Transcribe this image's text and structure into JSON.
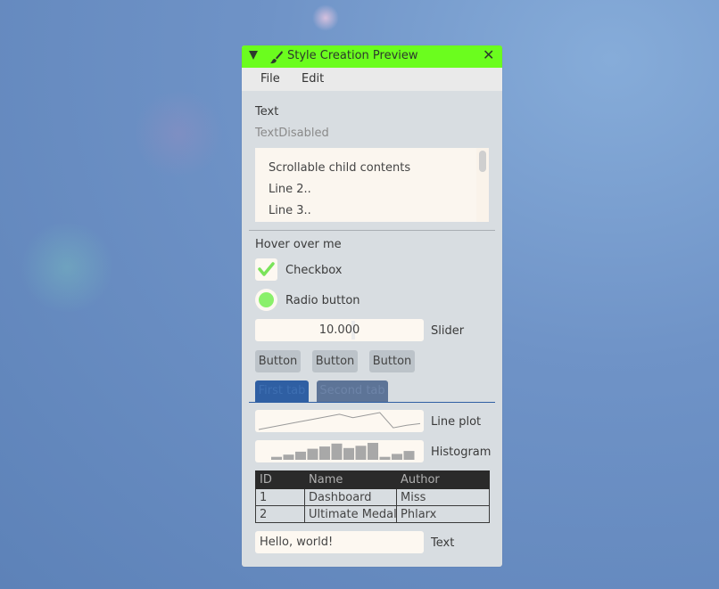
{
  "window": {
    "title": "Style Creation Preview",
    "title_bar_color": "#6bfd1e",
    "icons": [
      "collapse-arrow-icon",
      "paintbrush-icon",
      "close-icon"
    ]
  },
  "menu": {
    "file": "File",
    "edit": "Edit"
  },
  "text_label": "Text",
  "text_disabled_label": "TextDisabled",
  "child_lines": [
    "Scrollable child contents",
    "Line 2..",
    "Line 3.."
  ],
  "hover_label": "Hover over me",
  "checkbox": {
    "label": "Checkbox",
    "checked": true
  },
  "radio": {
    "label": "Radio button",
    "selected": true
  },
  "slider": {
    "value": "10.000",
    "label": "Slider"
  },
  "buttons": [
    "Button",
    "Button",
    "Button"
  ],
  "tabs": [
    "First tab",
    "Second tab"
  ],
  "line_plot": {
    "label": "Line plot",
    "values": [
      0.0,
      0.15,
      0.3,
      0.45,
      0.6,
      0.75,
      0.9,
      0.7,
      0.85,
      1.0,
      0.1,
      0.25,
      0.35
    ]
  },
  "histogram": {
    "label": "Histogram",
    "values": [
      0.2,
      0.35,
      0.55,
      0.75,
      0.9,
      1.1,
      0.8,
      0.95,
      1.15,
      0.2,
      0.4,
      0.6
    ]
  },
  "table": {
    "headers": [
      "ID",
      "Name",
      "Author"
    ],
    "rows": [
      [
        "1",
        "Dashboard",
        "Miss"
      ],
      [
        "2",
        "Ultimate Medals",
        "Phlarx"
      ]
    ]
  },
  "input": {
    "value": "Hello, world!",
    "label": "Text"
  }
}
